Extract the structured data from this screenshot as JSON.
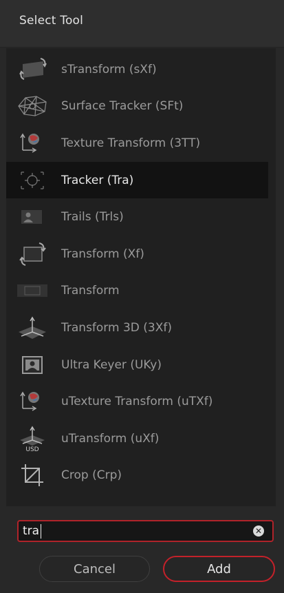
{
  "dialog": {
    "title": "Select Tool"
  },
  "tools": [
    {
      "label": "sTransform (sXf)",
      "icon": "stransform-icon"
    },
    {
      "label": "Surface Tracker (SFt)",
      "icon": "surface-tracker-icon"
    },
    {
      "label": "Texture Transform (3TT)",
      "icon": "texture-transform-icon"
    },
    {
      "label": "Tracker (Tra)",
      "icon": "tracker-icon",
      "selected": true
    },
    {
      "label": "Trails (Trls)",
      "icon": "trails-icon"
    },
    {
      "label": "Transform (Xf)",
      "icon": "transform-icon"
    },
    {
      "label": "Transform",
      "icon": "transform-rect-icon"
    },
    {
      "label": "Transform 3D (3Xf)",
      "icon": "transform-3d-icon"
    },
    {
      "label": "Ultra Keyer (UKy)",
      "icon": "ultra-keyer-icon"
    },
    {
      "label": "uTexture Transform (uTXf)",
      "icon": "utexture-transform-icon"
    },
    {
      "label": "uTransform (uXf)",
      "icon": "utransform-icon",
      "badge": "USD"
    },
    {
      "label": "Crop (Crp)",
      "icon": "crop-icon"
    }
  ],
  "search": {
    "value": "tra"
  },
  "buttons": {
    "cancel": "Cancel",
    "add": "Add"
  },
  "colors": {
    "accent_red": "#c4212a",
    "selected_row": "#121212",
    "background": "#282828"
  }
}
